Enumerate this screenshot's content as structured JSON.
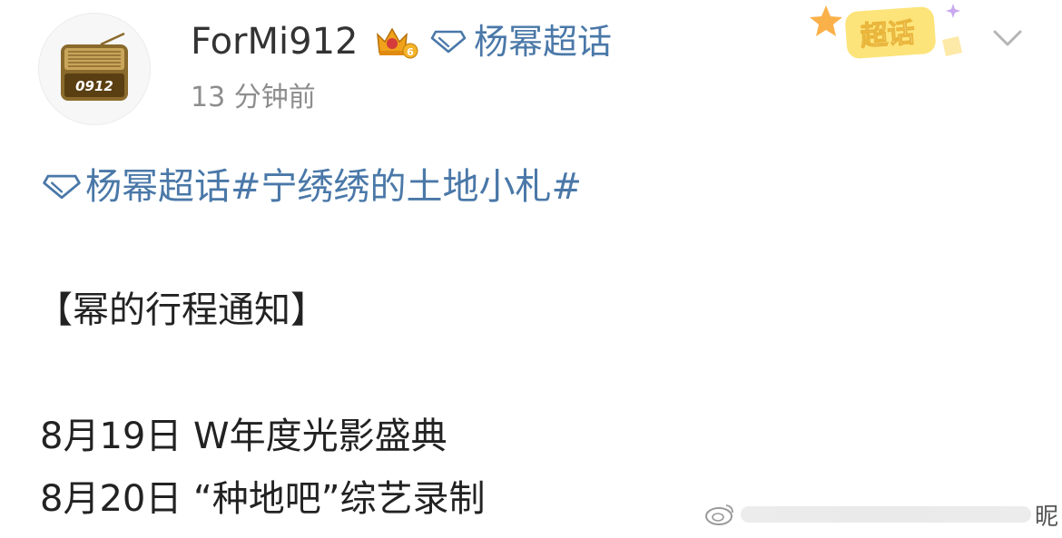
{
  "post": {
    "author": {
      "username": "ForMi912",
      "avatar_text": "0912",
      "avatar_icon": "radio-icon",
      "badge_icon": "crown-level-icon",
      "badge_level": "6"
    },
    "supertopic": {
      "label": "杨幂超话",
      "icon": "diamond-icon"
    },
    "timestamp": "13 分钟前",
    "chaohua_badge": "超话",
    "menu_icon": "chevron-down-icon",
    "content": {
      "topic_line": "杨幂超话#宁绣绣的土地小札#",
      "section_title": "【幂的行程通知】",
      "schedule": [
        "8月19日 W年度光影盛典",
        "8月20日 “种地吧”综艺录制"
      ]
    },
    "watermark": {
      "suffix": "昵"
    }
  },
  "colors": {
    "link": "#4a78a8",
    "text": "#222222",
    "muted": "#8d8d8d",
    "badge_yellow": "#fde47a"
  }
}
